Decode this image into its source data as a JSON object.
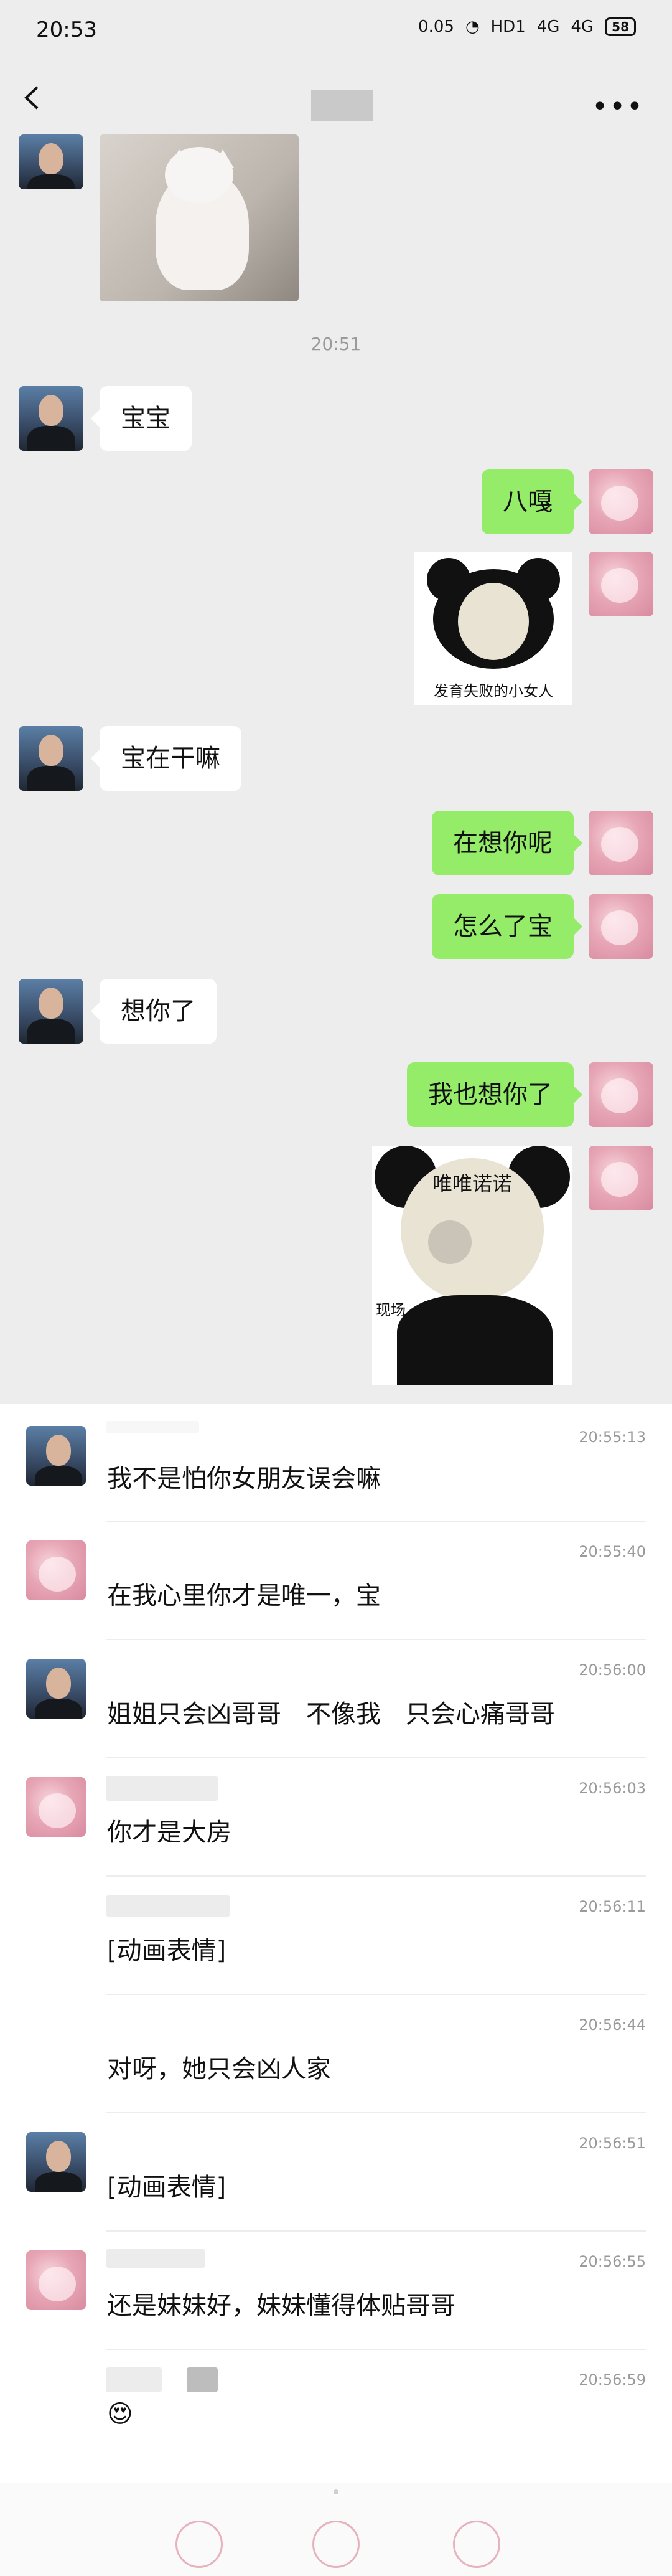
{
  "status_bar": {
    "time": "20:53",
    "network_speed": "0.05",
    "hd_label": "HD1",
    "signal1": "4G",
    "signal2": "4G",
    "battery": "58"
  },
  "nav": {
    "back_icon": "chevron-left-icon",
    "more_label": "•••"
  },
  "chat": {
    "timestamp": "20:51",
    "messages": [
      {
        "side": "left",
        "text": "宝宝"
      },
      {
        "side": "right",
        "text": "八嘎"
      },
      {
        "side": "right",
        "sticker_caption": "发育失败的小女人"
      },
      {
        "side": "left",
        "text": "宝在干嘛"
      },
      {
        "side": "right",
        "text": "在想你呢"
      },
      {
        "side": "right",
        "text": "怎么了宝"
      },
      {
        "side": "left",
        "text": "想你了"
      },
      {
        "side": "right",
        "text": "我也想你了"
      },
      {
        "side": "right",
        "sticker_caption": "唯唯诺诺",
        "sticker_caption2": "现场"
      }
    ]
  },
  "records": [
    {
      "avatar": "male",
      "time": "20:55:13",
      "text": "我不是怕你女朋友误会嘛"
    },
    {
      "avatar": "female",
      "time": "20:55:40",
      "text": "在我心里你才是唯一，宝"
    },
    {
      "avatar": "male",
      "time": "20:56:00",
      "text": "姐姐只会凶哥哥　不像我　只会心痛哥哥"
    },
    {
      "avatar": "female",
      "time": "20:56:03",
      "text": "你才是大房"
    },
    {
      "avatar": "none",
      "time": "20:56:11",
      "text": "[动画表情]"
    },
    {
      "avatar": "none",
      "time": "20:56:44",
      "text": "对呀，她只会凶人家"
    },
    {
      "avatar": "male",
      "time": "20:56:51",
      "text": "[动画表情]"
    },
    {
      "avatar": "female",
      "time": "20:56:55",
      "text": "还是妹妹好，妹妹懂得体贴哥哥"
    },
    {
      "avatar": "none",
      "time": "20:56:59",
      "text": "😍"
    }
  ],
  "colors": {
    "bubble_right": "#95ec69",
    "bubble_left": "#ffffff",
    "background": "#ededed"
  }
}
